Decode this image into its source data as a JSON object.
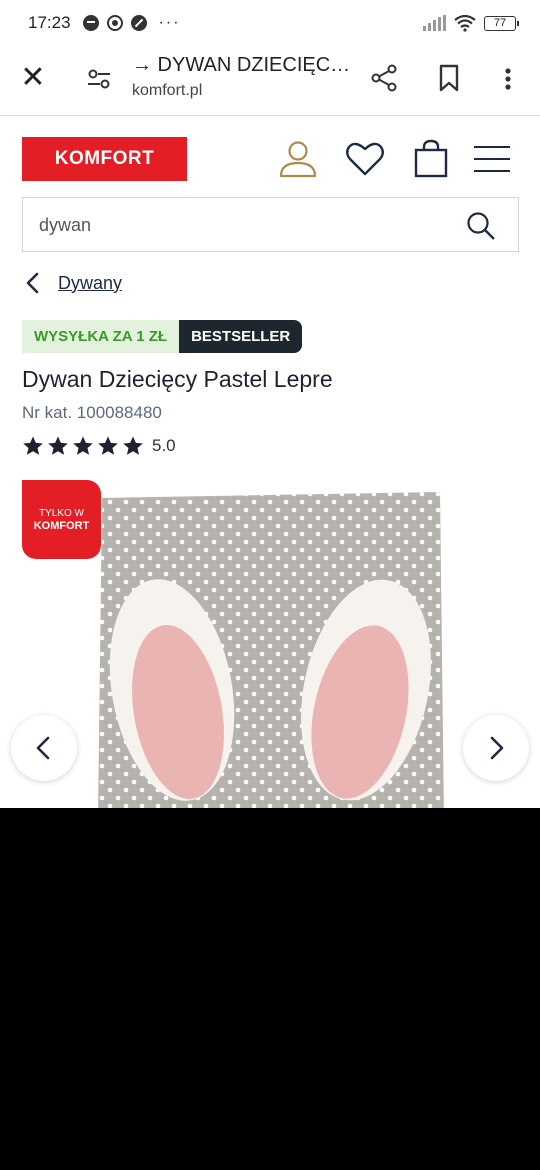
{
  "status_bar": {
    "time": "17:23",
    "battery": "77"
  },
  "browser": {
    "title": "→ DYWAN DZIECIĘCY PASTEL LEPRE",
    "url": "komfort.pl"
  },
  "site": {
    "logo": "KOMFORT",
    "search_value": "dywan",
    "brand_color": "#e31f25"
  },
  "breadcrumb": {
    "label": "Dywany"
  },
  "badges": {
    "shipping": "WYSYŁKA ZA 1 ZŁ",
    "bestseller": "BESTSELLER"
  },
  "product": {
    "title": "Dywan Dziecięcy Pastel Lepre",
    "sku": "Nr kat. 100088480",
    "rating_value": "5.0",
    "stars": 5
  },
  "gallery": {
    "exclusive_badge_line1": "TYLKO W",
    "exclusive_badge_line2": "KOMFORT"
  }
}
